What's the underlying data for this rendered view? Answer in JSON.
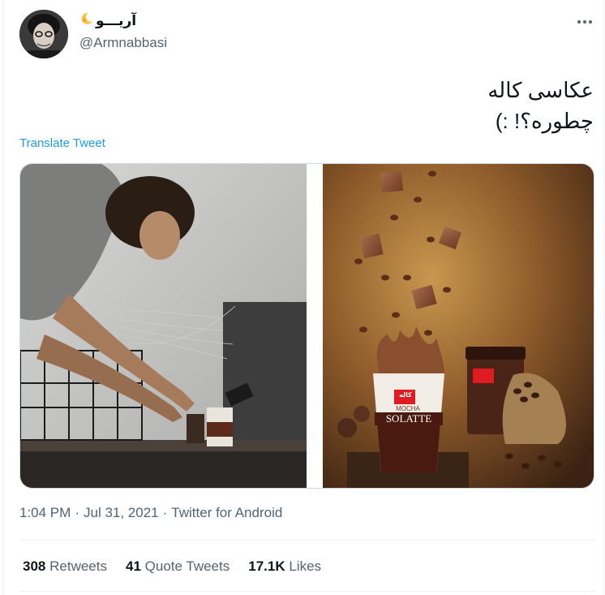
{
  "user": {
    "display_name": "آریـــو",
    "handle": "@Armnabbasi",
    "emoji": "crescent-star-emoji"
  },
  "tweet": {
    "lines": [
      "عکاسی کاله",
      "چطوره؟! :)"
    ]
  },
  "translate_label": "Translate Tweet",
  "media": {
    "right_cup": {
      "brand": "کاله",
      "flavor": "MOCHA",
      "product": "SOLATTE"
    }
  },
  "meta": {
    "time": "1:04 PM",
    "date": "Jul 31, 2021",
    "source": "Twitter for Android",
    "separator": "·"
  },
  "stats": {
    "retweets": {
      "count": "308",
      "label": "Retweets"
    },
    "quotes": {
      "count": "41",
      "label": "Quote Tweets"
    },
    "likes": {
      "count": "17.1K",
      "label": "Likes"
    }
  },
  "colors": {
    "accent": "#1d9bf0",
    "secondary_text": "#536471",
    "divider": "#eff3f4"
  }
}
